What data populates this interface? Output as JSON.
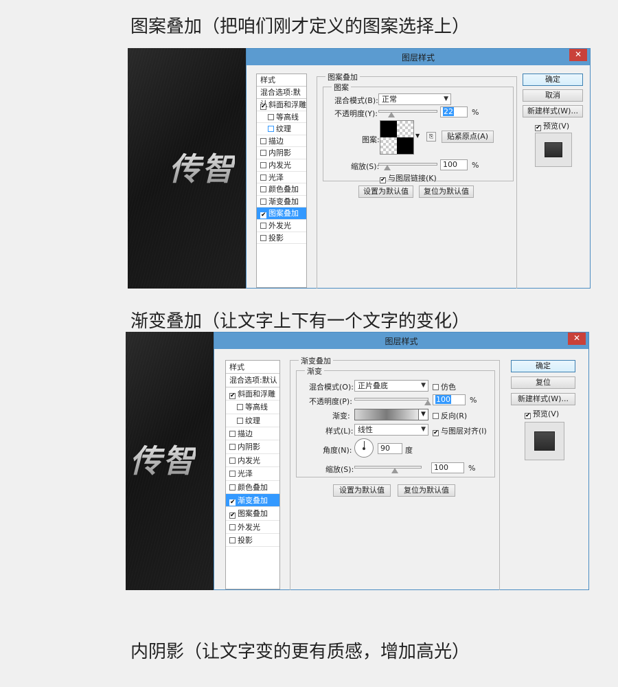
{
  "headings": {
    "h1": "图案叠加（把咱们刚才定义的图案选择上）",
    "h2": "渐变叠加（让文字上下有一个文字的变化）",
    "h3": "内阴影（让文字变的更有质感，增加高光）"
  },
  "logo_text": "传智",
  "dialog_title": "图层样式",
  "close_glyph": "✕",
  "check_glyph": "✔",
  "style_list": {
    "header": "样式",
    "blend_default": "混合选项:默认",
    "items": [
      "斜面和浮雕",
      "等高线",
      "纹理",
      "描边",
      "内阴影",
      "内发光",
      "光泽",
      "颜色叠加",
      "渐变叠加",
      "图案叠加",
      "外发光",
      "投影"
    ]
  },
  "dialog1": {
    "group_title": "图案叠加",
    "sub_group_title": "图案",
    "blend_mode_label": "混合模式(B):",
    "blend_mode_value": "正常",
    "opacity_label": "不透明度(Y):",
    "opacity_value": "22",
    "opacity_unit": "%",
    "opacity_level": 0.22,
    "pattern_label": "图案:",
    "snap_button": "贴紧原点(A)",
    "scale_label": "缩放(S):",
    "scale_value": "100",
    "scale_unit": "%",
    "scale_level": 0.14,
    "link_label": "与图层链接(K)",
    "set_default": "设置为默认值",
    "reset_default": "复位为默认值",
    "ok": "确定",
    "cancel": "取消",
    "new_style": "新建样式(W)...",
    "preview": "预览(V)"
  },
  "dialog2": {
    "group_title": "渐变叠加",
    "sub_group_title": "渐变",
    "blend_mode_label": "混合模式(O):",
    "blend_mode_value": "正片叠底",
    "dither_label": "仿色",
    "opacity_label": "不透明度(P):",
    "opacity_value": "100",
    "opacity_unit": "%",
    "opacity_level": 1.0,
    "gradient_label": "渐变:",
    "reverse_label": "反向(R)",
    "style_label": "样式(L):",
    "style_value": "线性",
    "align_label": "与图层对齐(I)",
    "angle_label": "角度(N):",
    "angle_value": "90",
    "angle_unit": "度",
    "scale_label": "缩放(S):",
    "scale_value": "100",
    "scale_unit": "%",
    "scale_level": 0.6,
    "set_default": "设置为默认值",
    "reset_default": "复位为默认值",
    "ok": "确定",
    "reset": "复位",
    "new_style": "新建样式(W)...",
    "preview": "预览(V)"
  }
}
